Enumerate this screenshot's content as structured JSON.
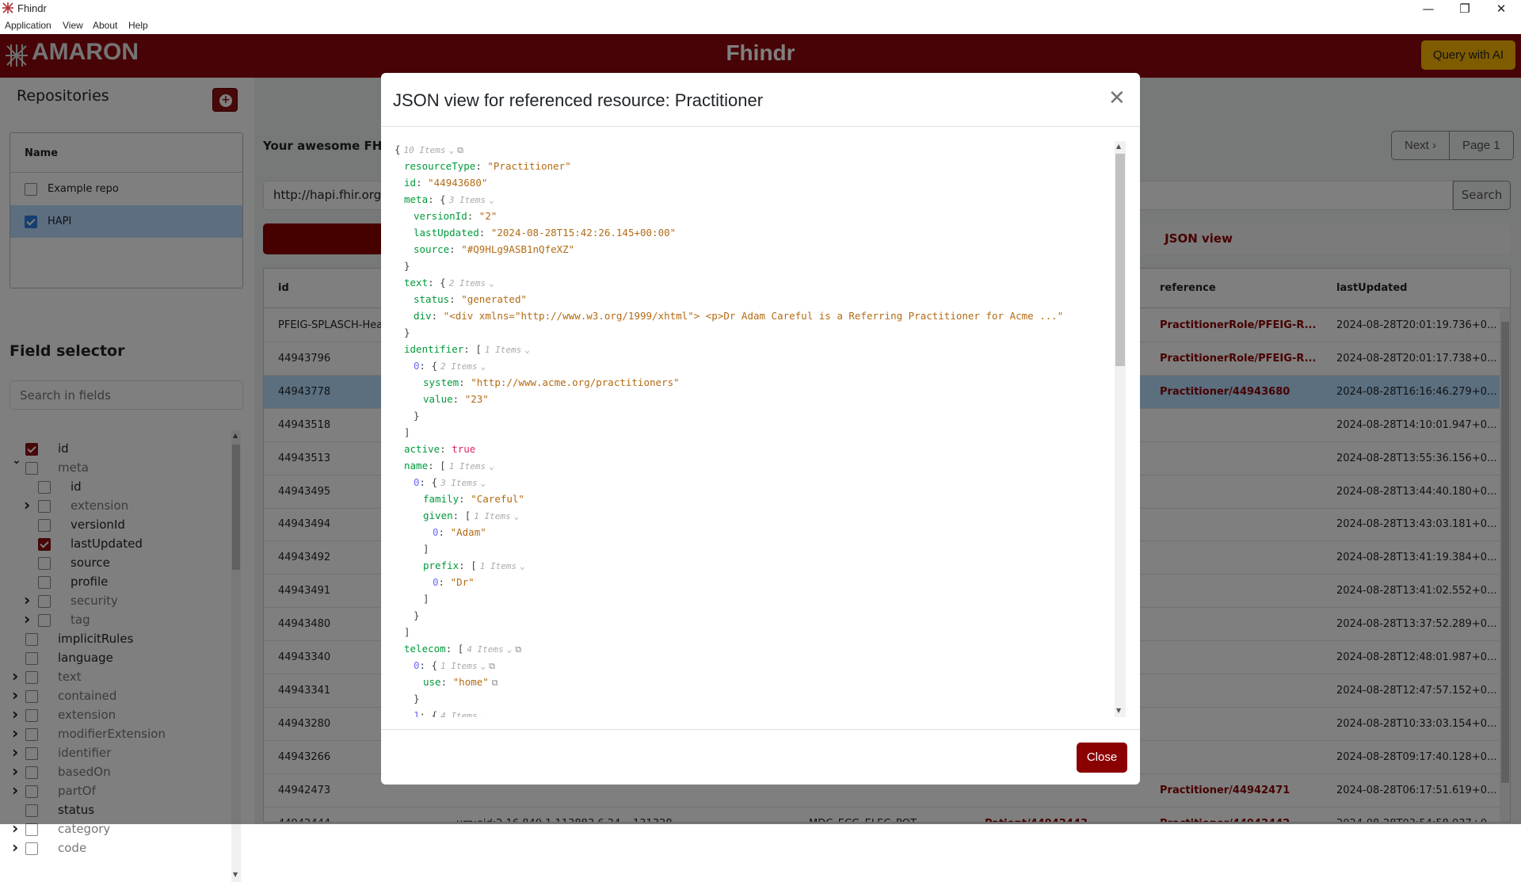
{
  "window": {
    "title": "Fhindr",
    "controls": [
      "minimize",
      "restore",
      "close"
    ]
  },
  "menu": [
    "Application",
    "View",
    "About",
    "Help"
  ],
  "header": {
    "logo": "AMARON",
    "title": "Fhindr",
    "ai_button": "Query with AI"
  },
  "colors": {
    "brand": "#8e060c",
    "accent": "#ffb800",
    "json_key": "#009a3a",
    "json_string": "#b36b14",
    "json_index": "#6b6bff",
    "json_bool": "#e0245e"
  },
  "sidebar": {
    "repos_title": "Repositories",
    "repo_table_header": "Name",
    "repos": [
      {
        "name": "Example repo",
        "checked": false
      },
      {
        "name": "HAPI",
        "checked": true,
        "selected": true
      }
    ],
    "field_title": "Field selector",
    "field_search_placeholder": "Search in fields",
    "fields": [
      {
        "label": "id",
        "level": 0,
        "checked": true
      },
      {
        "label": "meta",
        "level": 0,
        "expand": "open",
        "complex": true
      },
      {
        "label": "id",
        "level": 1
      },
      {
        "label": "extension",
        "level": 1,
        "expand": "closed",
        "complex": true
      },
      {
        "label": "versionId",
        "level": 1
      },
      {
        "label": "lastUpdated",
        "level": 1,
        "checked": true
      },
      {
        "label": "source",
        "level": 1
      },
      {
        "label": "profile",
        "level": 1
      },
      {
        "label": "security",
        "level": 1,
        "expand": "closed",
        "complex": true
      },
      {
        "label": "tag",
        "level": 1,
        "expand": "closed",
        "complex": true
      },
      {
        "label": "implicitRules",
        "level": 0
      },
      {
        "label": "language",
        "level": 0
      },
      {
        "label": "text",
        "level": 0,
        "expand": "closed",
        "complex": true
      },
      {
        "label": "contained",
        "level": 0,
        "expand": "closed",
        "complex": true
      },
      {
        "label": "extension",
        "level": 0,
        "expand": "closed",
        "complex": true
      },
      {
        "label": "modifierExtension",
        "level": 0,
        "expand": "closed",
        "complex": true
      },
      {
        "label": "identifier",
        "level": 0,
        "expand": "closed",
        "complex": true
      },
      {
        "label": "basedOn",
        "level": 0,
        "expand": "closed",
        "complex": true
      },
      {
        "label": "partOf",
        "level": 0,
        "expand": "closed",
        "complex": true
      },
      {
        "label": "status",
        "level": 0
      },
      {
        "label": "category",
        "level": 0,
        "expand": "closed",
        "complex": true
      },
      {
        "label": "code",
        "level": 0,
        "expand": "closed",
        "complex": true
      }
    ]
  },
  "main": {
    "title": "Your awesome FHIR",
    "next": "Next ›",
    "page": "Page 1",
    "url": "http://hapi.fhir.org/",
    "search": "Search",
    "tab_json": "JSON view",
    "columns": [
      "id",
      "reference",
      "lastUpdated"
    ],
    "rows": [
      {
        "id": "PFEIG-SPLASCH-Hea",
        "reference": "PractitionerRole/PFEIG-R...",
        "lastUpdated": "2024-08-28T20:01:19.736+0..."
      },
      {
        "id": "44943796",
        "reference": "PractitionerRole/PFEIG-R...",
        "lastUpdated": "2024-08-28T20:01:17.738+0..."
      },
      {
        "id": "44943778",
        "reference": "Practitioner/44943680",
        "lastUpdated": "2024-08-28T16:16:46.279+0...",
        "selected": true
      },
      {
        "id": "44943518",
        "reference": "",
        "lastUpdated": "2024-08-28T14:10:01.947+0..."
      },
      {
        "id": "44943513",
        "reference": "",
        "lastUpdated": "2024-08-28T13:55:36.156+0..."
      },
      {
        "id": "44943495",
        "reference": "",
        "lastUpdated": "2024-08-28T13:44:40.180+0..."
      },
      {
        "id": "44943494",
        "reference": "",
        "lastUpdated": "2024-08-28T13:43:03.181+0..."
      },
      {
        "id": "44943492",
        "reference": "",
        "lastUpdated": "2024-08-28T13:41:19.384+0..."
      },
      {
        "id": "44943491",
        "reference": "",
        "lastUpdated": "2024-08-28T13:41:02.552+0..."
      },
      {
        "id": "44943480",
        "reference": "",
        "lastUpdated": "2024-08-28T13:37:52.289+0..."
      },
      {
        "id": "44943340",
        "reference": "",
        "lastUpdated": "2024-08-28T12:48:01.987+0..."
      },
      {
        "id": "44943341",
        "reference": "",
        "lastUpdated": "2024-08-28T12:47:57.152+0..."
      },
      {
        "id": "44943280",
        "reference": "",
        "lastUpdated": "2024-08-28T10:33:03.154+0..."
      },
      {
        "id": "44943266",
        "reference": "",
        "lastUpdated": "2024-08-28T09:17:40.128+0..."
      },
      {
        "id": "44942473",
        "reference": "Practitioner/44942471",
        "lastUpdated": "2024-08-28T06:17:51.619+0..."
      },
      {
        "id": "44942444",
        "c2": "urn:oid:2.16.840.1.113883.6.24",
        "c3": "131328",
        "c4": "MDC_ECG_ELEC_POT",
        "c5": "Patient/44942443",
        "reference": "Practitioner/44942442",
        "lastUpdated": "2024-08-28T03:54:58.037+0..."
      }
    ]
  },
  "modal": {
    "title": "JSON view for referenced resource: Practitioner",
    "close": "Close",
    "lines": [
      {
        "i": 0,
        "open": "{",
        "meta": "10 Items",
        "copy": true
      },
      {
        "i": 1,
        "k": "resourceType",
        "v": "\"Practitioner\""
      },
      {
        "i": 1,
        "k": "id",
        "v": "\"44943680\""
      },
      {
        "i": 1,
        "k": "meta",
        "open": "{",
        "meta": "3 Items"
      },
      {
        "i": 2,
        "k": "versionId",
        "v": "\"2\""
      },
      {
        "i": 2,
        "k": "lastUpdated",
        "v": "\"2024-08-28T15:42:26.145+00:00\""
      },
      {
        "i": 2,
        "k": "source",
        "v": "\"#Q9HLg9ASB1nQfeXZ\""
      },
      {
        "i": 1,
        "close": "}"
      },
      {
        "i": 1,
        "k": "text",
        "open": "{",
        "meta": "2 Items"
      },
      {
        "i": 2,
        "k": "status",
        "v": "\"generated\""
      },
      {
        "i": 2,
        "k": "div",
        "v": "\"<div xmlns=\"http://www.w3.org/1999/xhtml\"> <p>Dr Adam Careful is a Referring Practitioner for Acme ...\""
      },
      {
        "i": 1,
        "close": "}"
      },
      {
        "i": 1,
        "k": "identifier",
        "open": "[",
        "meta": "1 Items"
      },
      {
        "i": 2,
        "idx": "0",
        "open": "{",
        "meta": "2 Items"
      },
      {
        "i": 3,
        "k": "system",
        "v": "\"http://www.acme.org/practitioners\""
      },
      {
        "i": 3,
        "k": "value",
        "v": "\"23\""
      },
      {
        "i": 2,
        "close": "}"
      },
      {
        "i": 1,
        "close": "]"
      },
      {
        "i": 1,
        "k": "active",
        "bool": "true"
      },
      {
        "i": 1,
        "k": "name",
        "open": "[",
        "meta": "1 Items"
      },
      {
        "i": 2,
        "idx": "0",
        "open": "{",
        "meta": "3 Items"
      },
      {
        "i": 3,
        "k": "family",
        "v": "\"Careful\""
      },
      {
        "i": 3,
        "k": "given",
        "open": "[",
        "meta": "1 Items"
      },
      {
        "i": 4,
        "idx": "0",
        "v": "\"Adam\""
      },
      {
        "i": 3,
        "close": "]"
      },
      {
        "i": 3,
        "k": "prefix",
        "open": "[",
        "meta": "1 Items"
      },
      {
        "i": 4,
        "idx": "0",
        "v": "\"Dr\""
      },
      {
        "i": 3,
        "close": "]"
      },
      {
        "i": 2,
        "close": "}"
      },
      {
        "i": 1,
        "close": "]"
      },
      {
        "i": 1,
        "k": "telecom",
        "open": "[",
        "meta": "4 Items",
        "copy": true
      },
      {
        "i": 2,
        "idx": "0",
        "open": "{",
        "meta": "1 Items",
        "copy": true
      },
      {
        "i": 3,
        "k": "use",
        "v": "\"home\"",
        "copy": true
      },
      {
        "i": 2,
        "close": "}"
      },
      {
        "i": 2,
        "idx": "1",
        "open": "{",
        "meta": "4 Items"
      }
    ]
  }
}
